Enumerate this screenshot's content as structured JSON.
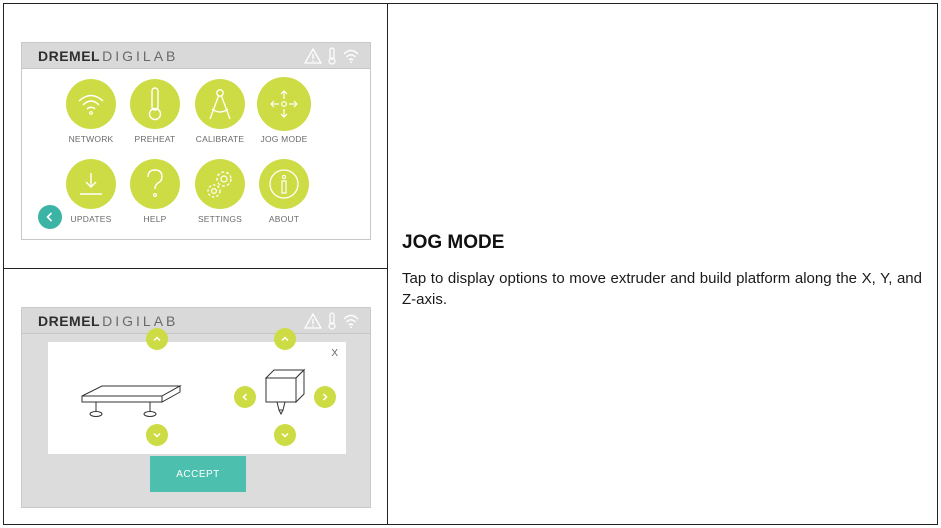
{
  "screen1": {
    "brand_bold": "DREMEL",
    "brand_light": "DIGILAB",
    "tiles": [
      {
        "label": "NETWORK",
        "icon": "wifi-icon"
      },
      {
        "label": "PREHEAT",
        "icon": "thermometer-icon"
      },
      {
        "label": "CALIBRATE",
        "icon": "compass-icon"
      },
      {
        "label": "JOG MODE",
        "icon": "move-arrows-icon"
      },
      {
        "label": "UPDATES",
        "icon": "download-icon"
      },
      {
        "label": "HELP",
        "icon": "question-icon"
      },
      {
        "label": "SETTINGS",
        "icon": "gears-icon"
      },
      {
        "label": "ABOUT",
        "icon": "info-icon"
      }
    ]
  },
  "screen2": {
    "brand_bold": "DREMEL",
    "brand_light": "DIGILAB",
    "close_label": "X",
    "accept_label": "ACCEPT"
  },
  "text": {
    "heading": "JOG MODE",
    "description": "Tap to display options to move extruder and build platform along the X, Y, and Z-axis."
  },
  "colors": {
    "tile": "#cddc45",
    "accent": "#4dbfae",
    "topbar": "#d9d9d9"
  }
}
